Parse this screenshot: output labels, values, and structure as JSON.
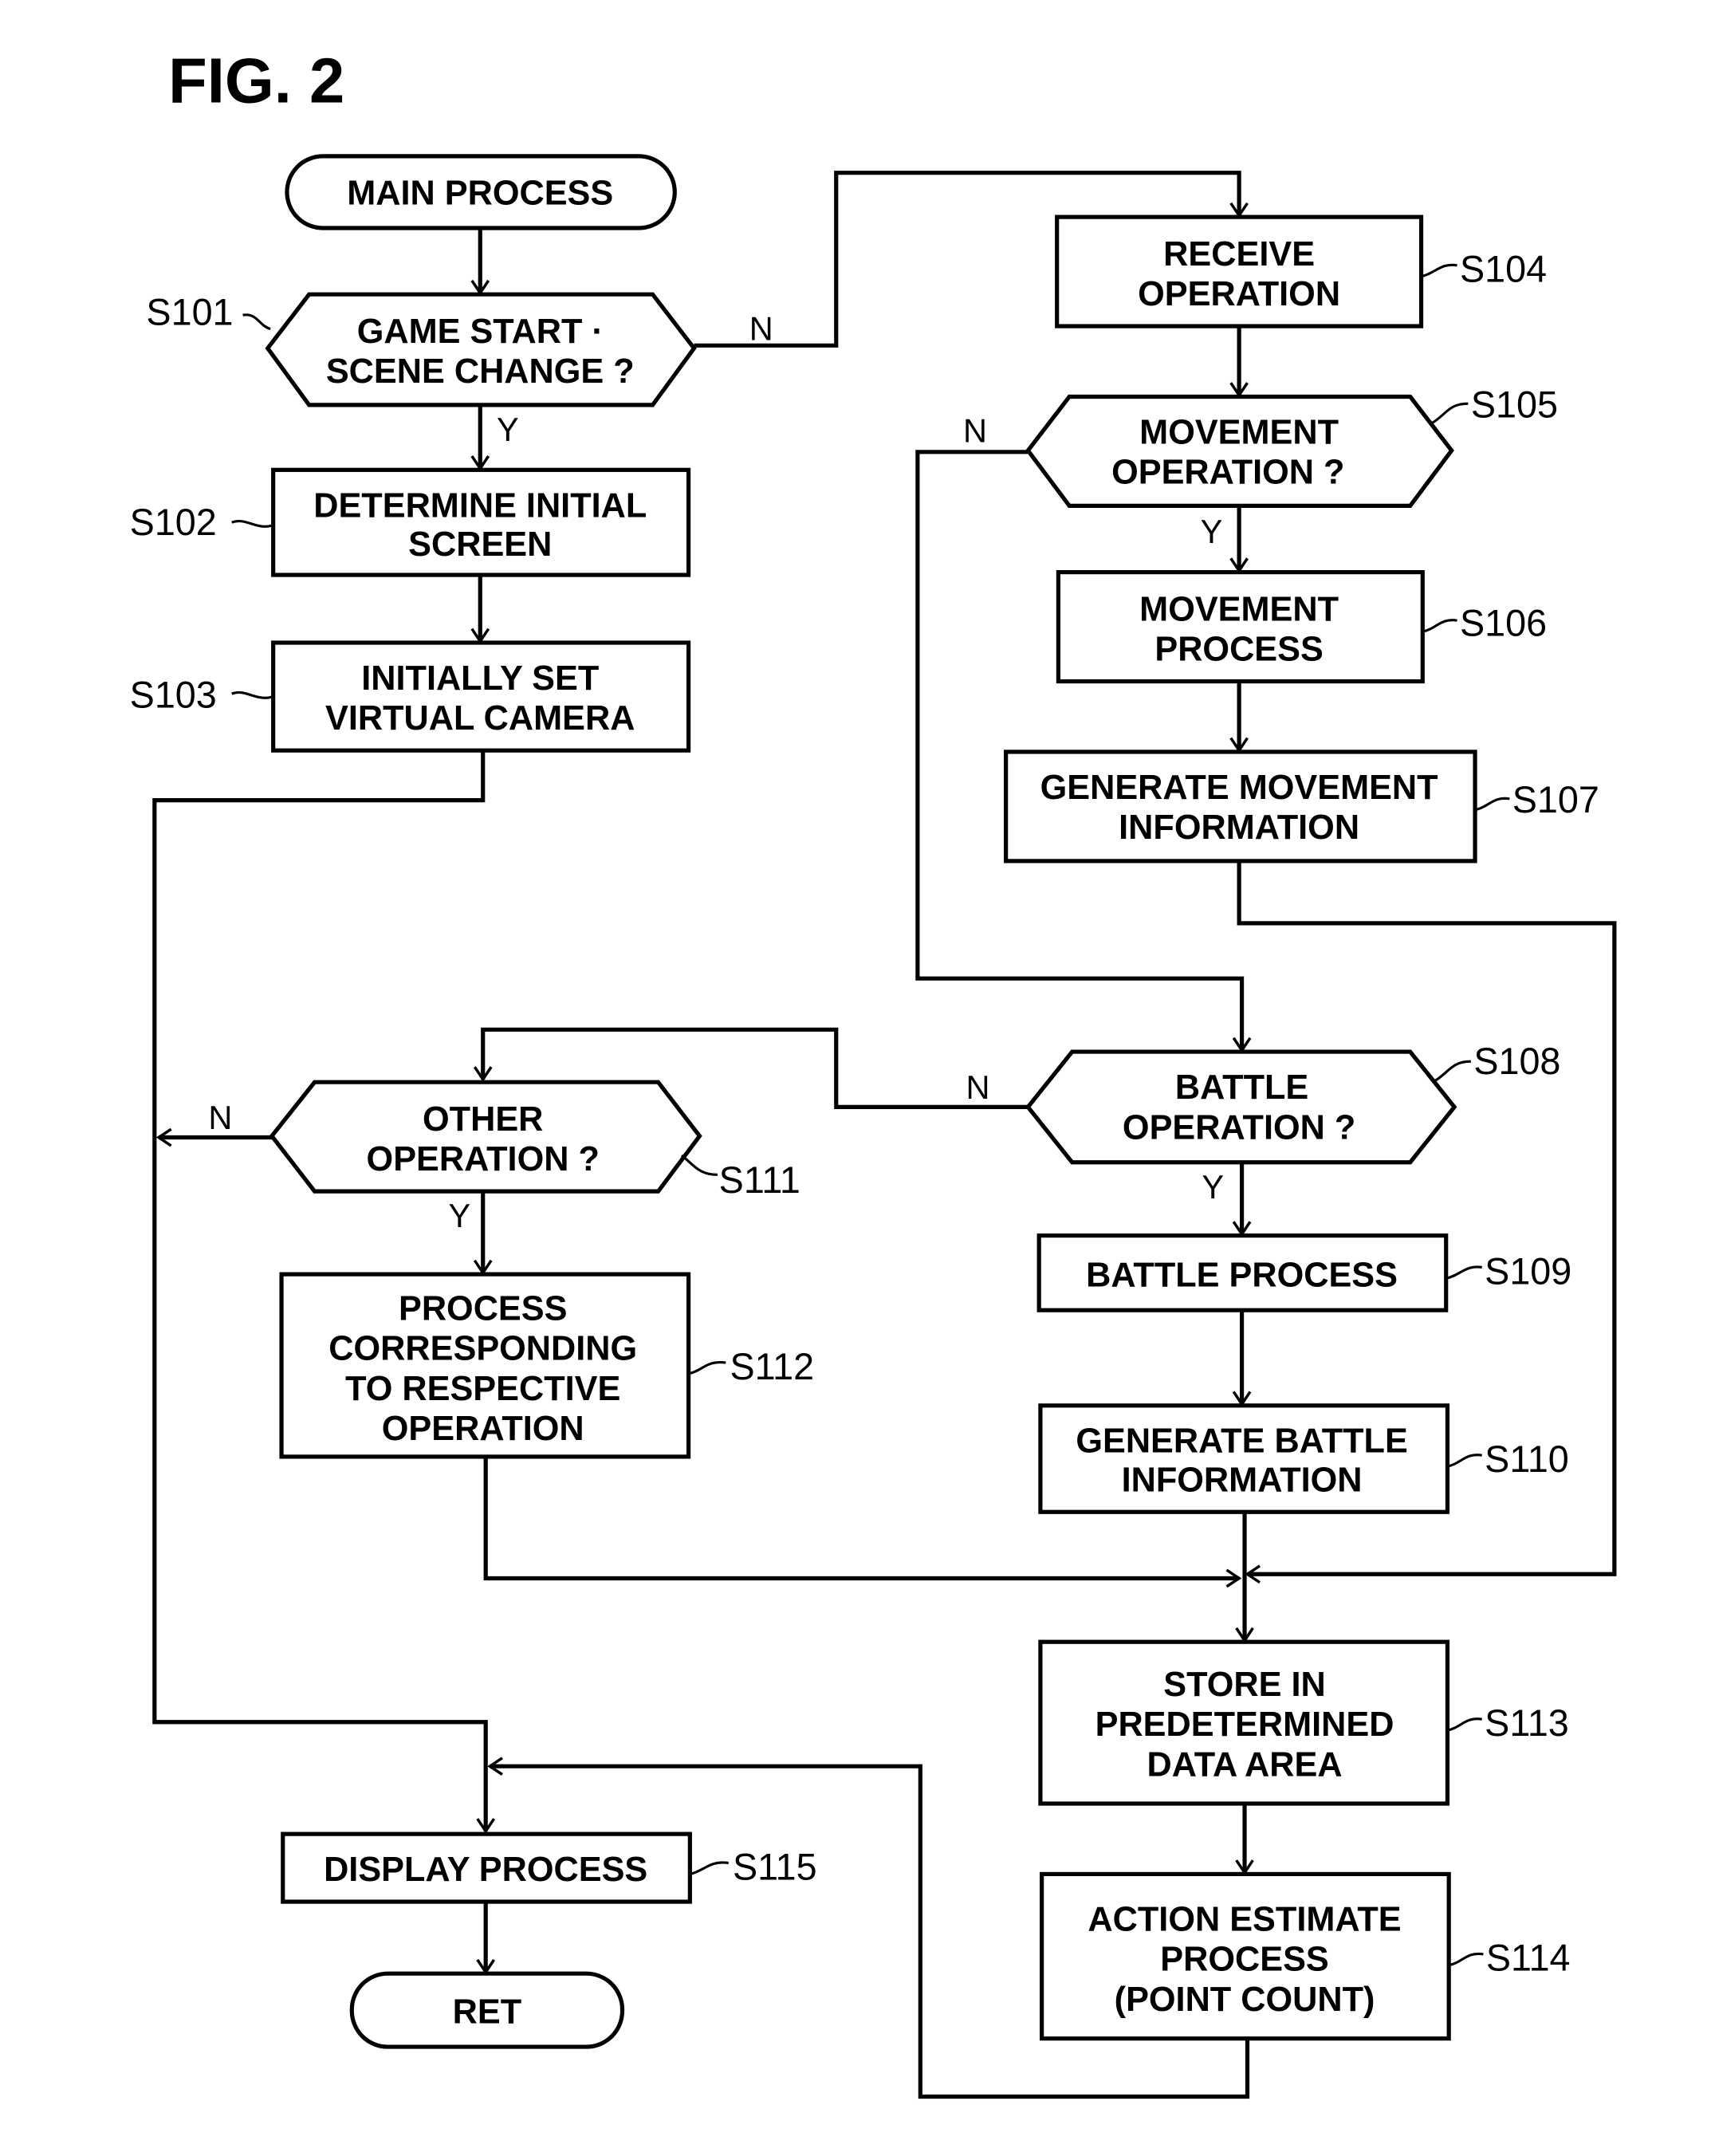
{
  "figure": {
    "title": "FIG. 2",
    "background_color": "#ffffff",
    "line_color": "#000000"
  },
  "nodes": {
    "start": {
      "type": "terminal",
      "lines": [
        "MAIN PROCESS"
      ]
    },
    "s101": {
      "id": "S101",
      "type": "decision",
      "lines": [
        "GAME START ·",
        "SCENE CHANGE ?"
      ],
      "yes": "Y",
      "no": "N"
    },
    "s102": {
      "id": "S102",
      "type": "process",
      "lines": [
        "DETERMINE INITIAL",
        "SCREEN"
      ]
    },
    "s103": {
      "id": "S103",
      "type": "process",
      "lines": [
        "INITIALLY SET",
        "VIRTUAL CAMERA"
      ]
    },
    "s104": {
      "id": "S104",
      "type": "process",
      "lines": [
        "RECEIVE",
        "OPERATION"
      ]
    },
    "s105": {
      "id": "S105",
      "type": "decision",
      "lines": [
        "MOVEMENT",
        "OPERATION ?"
      ],
      "yes": "Y",
      "no": "N"
    },
    "s106": {
      "id": "S106",
      "type": "process",
      "lines": [
        "MOVEMENT",
        "PROCESS"
      ]
    },
    "s107": {
      "id": "S107",
      "type": "process",
      "lines": [
        "GENERATE MOVEMENT",
        "INFORMATION"
      ]
    },
    "s108": {
      "id": "S108",
      "type": "decision",
      "lines": [
        "BATTLE",
        "OPERATION ?"
      ],
      "yes": "Y",
      "no": "N"
    },
    "s109": {
      "id": "S109",
      "type": "process",
      "lines": [
        "BATTLE PROCESS"
      ]
    },
    "s110": {
      "id": "S110",
      "type": "process",
      "lines": [
        "GENERATE BATTLE",
        "INFORMATION"
      ]
    },
    "s111": {
      "id": "S111",
      "type": "decision",
      "lines": [
        "OTHER",
        "OPERATION ?"
      ],
      "yes": "Y",
      "no": "N"
    },
    "s112": {
      "id": "S112",
      "type": "process",
      "lines": [
        "PROCESS",
        "CORRESPONDING",
        "TO RESPECTIVE",
        "OPERATION"
      ]
    },
    "s113": {
      "id": "S113",
      "type": "process",
      "lines": [
        "STORE IN",
        "PREDETERMINED",
        "DATA AREA"
      ]
    },
    "s114": {
      "id": "S114",
      "type": "process",
      "lines": [
        "ACTION ESTIMATE",
        "PROCESS",
        "(POINT COUNT)"
      ]
    },
    "s115": {
      "id": "S115",
      "type": "process",
      "lines": [
        "DISPLAY PROCESS"
      ]
    },
    "end": {
      "type": "terminal",
      "lines": [
        "RET"
      ]
    }
  },
  "edges": [
    {
      "from": "start",
      "to": "s101"
    },
    {
      "from": "s101",
      "to": "s102",
      "label": "Y"
    },
    {
      "from": "s101",
      "to": "s104",
      "label": "N"
    },
    {
      "from": "s102",
      "to": "s103"
    },
    {
      "from": "s103",
      "to": "s115"
    },
    {
      "from": "s104",
      "to": "s105"
    },
    {
      "from": "s105",
      "to": "s106",
      "label": "Y"
    },
    {
      "from": "s105",
      "to": "s108",
      "label": "N"
    },
    {
      "from": "s106",
      "to": "s107"
    },
    {
      "from": "s107",
      "to": "s113"
    },
    {
      "from": "s108",
      "to": "s109",
      "label": "Y"
    },
    {
      "from": "s108",
      "to": "s111",
      "label": "N"
    },
    {
      "from": "s109",
      "to": "s110"
    },
    {
      "from": "s110",
      "to": "s113"
    },
    {
      "from": "s111",
      "to": "s112",
      "label": "Y"
    },
    {
      "from": "s111",
      "to": "s115",
      "label": "N"
    },
    {
      "from": "s112",
      "to": "s113"
    },
    {
      "from": "s113",
      "to": "s114"
    },
    {
      "from": "s114",
      "to": "s115"
    },
    {
      "from": "s115",
      "to": "end"
    }
  ]
}
